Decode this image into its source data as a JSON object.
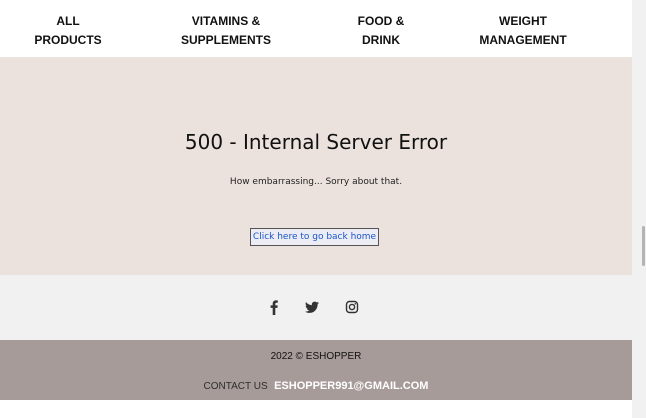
{
  "nav": {
    "items": [
      {
        "label": "ALL\nPRODUCTS"
      },
      {
        "label": "VITAMINS &\nSUPPLEMENTS"
      },
      {
        "label": "FOOD &\nDRINK"
      },
      {
        "label": "WEIGHT\nMANAGEMENT"
      }
    ]
  },
  "error": {
    "title": "500 - Internal Server Error",
    "message": "How embarrassing... Sorry about that.",
    "home_link": "Click here to go back home"
  },
  "social": {
    "icons": [
      "facebook-icon",
      "twitter-icon",
      "instagram-icon"
    ]
  },
  "footer": {
    "copyright": "2022 © ESHOPPER",
    "contact_label": "CONTACT US",
    "contact_email": "ESHOPPER991@GMAIL.COM"
  },
  "colors": {
    "hero_bg": "#ebe1dd",
    "footer_bg": "#a69b98",
    "social_bg": "#f1f1f1",
    "link": "#1a56c8"
  }
}
